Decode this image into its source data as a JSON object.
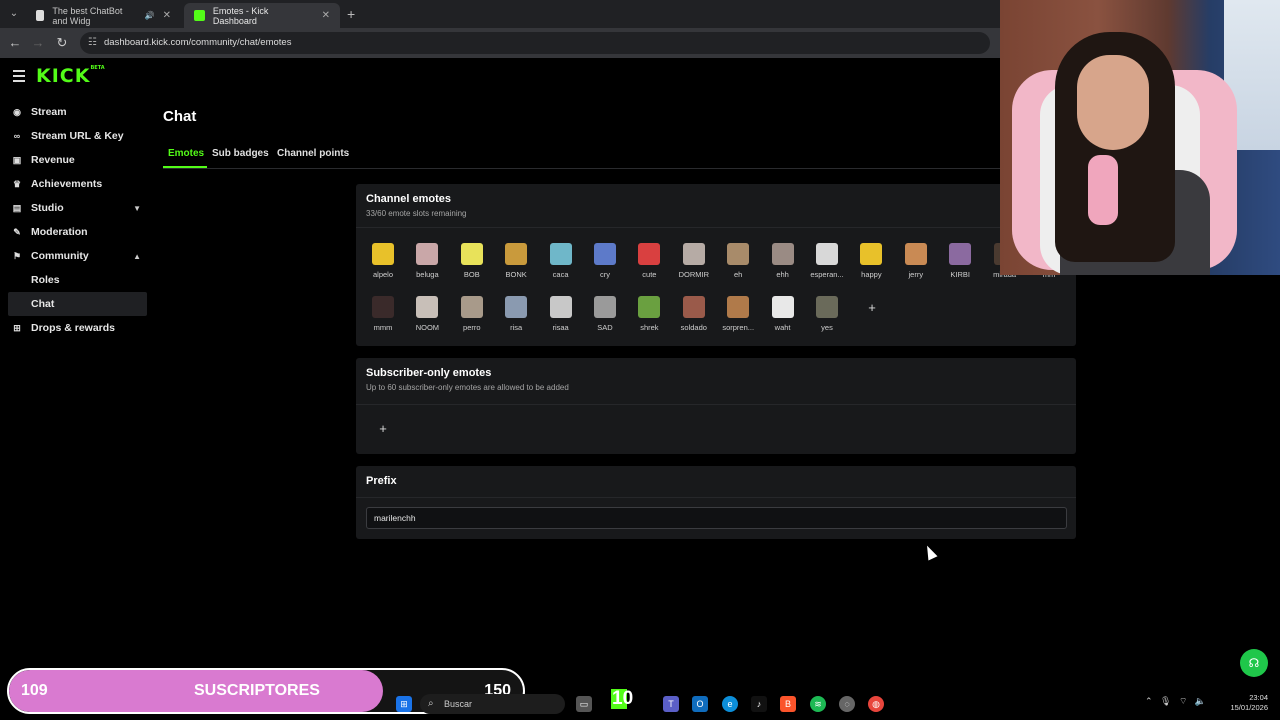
{
  "browser": {
    "tabs": [
      {
        "title": "The best ChatBot and Widg",
        "active": false
      },
      {
        "title": "Emotes - Kick Dashboard",
        "active": true
      }
    ],
    "url": "dashboard.kick.com/community/chat/emotes"
  },
  "app": {
    "logo": "KICK",
    "logo_badge": "BETA",
    "accent": "#53fc18"
  },
  "sidebar": {
    "items": [
      {
        "label": "Stream",
        "icon": "broadcast-icon"
      },
      {
        "label": "Stream URL & Key",
        "icon": "link-icon"
      },
      {
        "label": "Revenue",
        "icon": "revenue-icon"
      },
      {
        "label": "Achievements",
        "icon": "trophy-icon"
      },
      {
        "label": "Studio",
        "icon": "studio-icon",
        "expanded": false
      },
      {
        "label": "Moderation",
        "icon": "wrench-icon"
      },
      {
        "label": "Community",
        "icon": "community-icon",
        "expanded": true
      },
      {
        "label": "Roles",
        "sub": true
      },
      {
        "label": "Chat",
        "sub": true,
        "selected": true
      },
      {
        "label": "Drops & rewards",
        "icon": "gift-icon"
      }
    ]
  },
  "page": {
    "title": "Chat",
    "tabs": [
      "Emotes",
      "Sub badges",
      "Channel points"
    ],
    "active_tab": "Emotes"
  },
  "channel_emotes": {
    "title": "Channel emotes",
    "subtitle": "33/60 emote slots remaining",
    "emotes": [
      {
        "name": "alpelo",
        "color": "#e8c12a"
      },
      {
        "name": "beluga",
        "color": "#c9a7a8"
      },
      {
        "name": "BOB",
        "color": "#e8e25a"
      },
      {
        "name": "BONK",
        "color": "#c99a3c"
      },
      {
        "name": "caca",
        "color": "#6fb7c9"
      },
      {
        "name": "cry",
        "color": "#5d7ac9"
      },
      {
        "name": "cute",
        "color": "#d94040"
      },
      {
        "name": "DORMIR",
        "color": "#b6aba5"
      },
      {
        "name": "eh",
        "color": "#a88b6a"
      },
      {
        "name": "ehh",
        "color": "#9a8b84"
      },
      {
        "name": "esperan...",
        "color": "#d8d8d8"
      },
      {
        "name": "happy",
        "color": "#e8c12a"
      },
      {
        "name": "jerry",
        "color": "#c98a54"
      },
      {
        "name": "KIRBI",
        "color": "#8b6aa0"
      },
      {
        "name": "mirada",
        "color": "#4a3a30"
      },
      {
        "name": "mm",
        "color": "#5a4a40"
      },
      {
        "name": "mmm",
        "color": "#3a2a2a"
      },
      {
        "name": "NOOM",
        "color": "#c8bfb8"
      },
      {
        "name": "perro",
        "color": "#a89a8a"
      },
      {
        "name": "risa",
        "color": "#8a9ab0"
      },
      {
        "name": "risaa",
        "color": "#c8c8c8"
      },
      {
        "name": "SAD",
        "color": "#9a9a9a"
      },
      {
        "name": "shrek",
        "color": "#6aa040"
      },
      {
        "name": "soldado",
        "color": "#9a5a4a"
      },
      {
        "name": "sorpren...",
        "color": "#b07a4a"
      },
      {
        "name": "waht",
        "color": "#e8e8e8"
      },
      {
        "name": "yes",
        "color": "#6a6a5a"
      }
    ],
    "add_label": "+"
  },
  "subscriber_emotes": {
    "title": "Subscriber-only emotes",
    "subtitle": "Up to 60 subscriber-only emotes are allowed to be added",
    "add_label": "+"
  },
  "prefix": {
    "title": "Prefix",
    "value": "marilenchh"
  },
  "subscriber_goal": {
    "current": "109",
    "label": "SUSCRIPTORES",
    "goal": "150",
    "progress": 0.7267
  },
  "taskbar": {
    "search_placeholder": "Buscar",
    "kick_count": "10",
    "time": "23:04",
    "date": "15/01/2026"
  }
}
